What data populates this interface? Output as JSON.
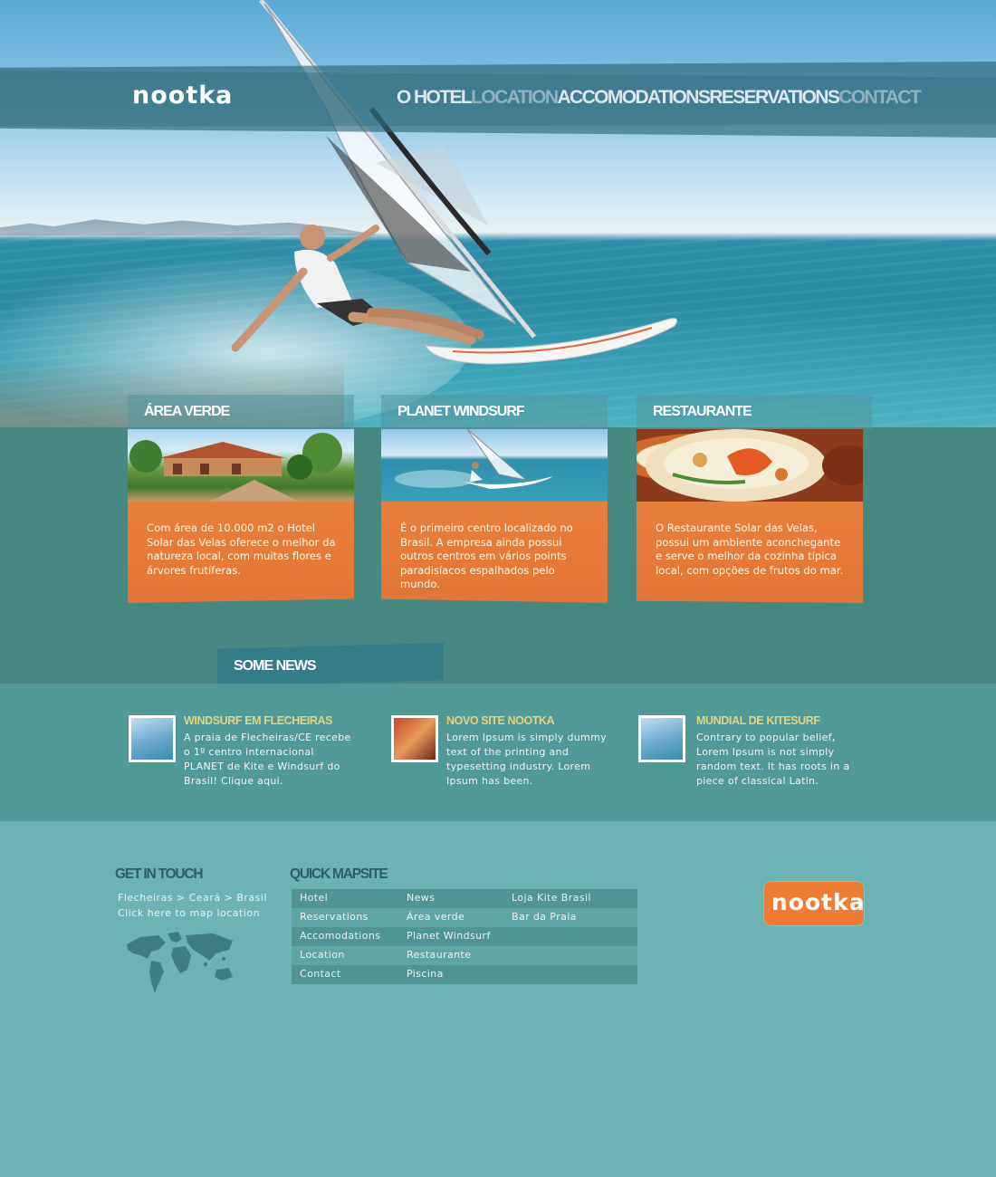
{
  "brand": {
    "logo_text": "nootka",
    "accent_color": "#ee7d32",
    "teal_color": "#478883"
  },
  "nav": {
    "items": [
      {
        "label": "O HOTEL",
        "state": "light"
      },
      {
        "label": "LOCATION",
        "state": "dim"
      },
      {
        "label": "ACCOMODATIONS",
        "state": "light"
      },
      {
        "label": "RESERVATIONS",
        "state": "light"
      },
      {
        "label": "CONTACT",
        "state": "dim"
      }
    ]
  },
  "features": [
    {
      "title": "ÁREA VERDE",
      "text": "Com área de 10.000 m2 o Hotel Solar das Velas oferece o melhor da natureza local, com muitas flores e árvores frutíferas."
    },
    {
      "title": "PLANET WINDSURF",
      "text": "É o primeiro centro localizado no Brasil. A empresa ainda possui outros centros em vários points paradisíacos espalhados pelo mundo."
    },
    {
      "title": "RESTAURANTE",
      "text": "O Restaurante Solar das Velas, possui um ambiente aconchegante e serve o melhor da cozinha típica local, com opções de frutos do mar."
    }
  ],
  "news": {
    "section_title": "SOME NEWS",
    "items": [
      {
        "title": "WINDSURF EM FLECHEIRAS",
        "text": "A praia de Flecheiras/CE recebe o 1º centro internacional PLANET de Kite e Windsurf do Brasil! Clique aqui."
      },
      {
        "title": "NOVO SITE NOOTKA",
        "text": "Lorem Ipsum is simply dummy text of the printing and typesetting industry. Lorem Ipsum has been."
      },
      {
        "title": "MUNDIAL DE KITESURF",
        "text": "Contrary to popular belief, Lorem Ipsum is not simply random text. It has roots in a piece of classical Latin."
      }
    ]
  },
  "footer": {
    "contact_title": "GET IN TOUCH",
    "address": "Flecheiras > Ceará > Brasil",
    "map_link": "Click here to map location",
    "sitemap_title": "QUICK MAPSITE",
    "sitemap_rows": [
      [
        "Hotel",
        "News",
        "Loja Kite Brasil"
      ],
      [
        "Reservations",
        "Área verde",
        "Bar da Praia"
      ],
      [
        "Accomodations",
        "Planet Windsurf",
        ""
      ],
      [
        "Location",
        "Restaurante",
        ""
      ],
      [
        "Contact",
        "Piscina",
        ""
      ]
    ],
    "logo_text": "nootka"
  }
}
